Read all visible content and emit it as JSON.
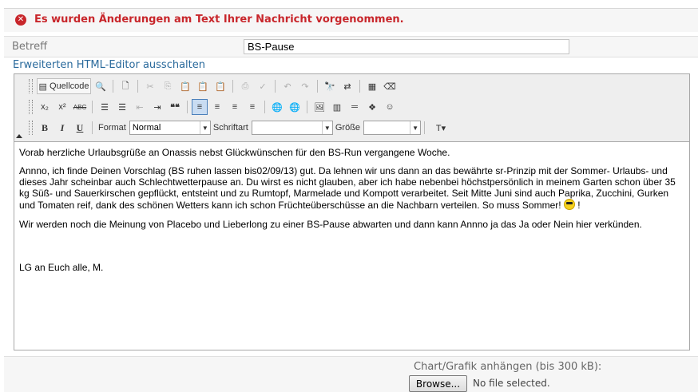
{
  "notice": {
    "text": "Es wurden Änderungen am Text Ihrer Nachricht vorgenommen.",
    "color": "#c8262b"
  },
  "subject": {
    "label": "Betreff",
    "value": "BS-Pause"
  },
  "editor_toggle": "Erweiterten HTML-Editor ausschalten",
  "toolbar": {
    "source_label": "Quellcode",
    "row1_icons": [
      "preview-icon",
      "new-page-icon",
      "cut-icon",
      "copy-icon",
      "paste-icon",
      "paste-text-icon",
      "paste-word-icon",
      "print-icon",
      "spellcheck-icon",
      "undo-icon",
      "redo-icon",
      "find-icon",
      "replace-icon",
      "select-all-icon",
      "remove-format-icon"
    ],
    "subscript": "x₂",
    "superscript": "x²",
    "strike": "ABC",
    "blockquote": "❝❝",
    "bold": "B",
    "italic": "I",
    "underline": "U",
    "format_label": "Format",
    "format_value": "Normal",
    "font_label": "Schriftart",
    "font_value": "",
    "size_label": "Größe",
    "size_value": ""
  },
  "content": {
    "p1": "Vorab herzliche Urlaubsgrüße an Onassis nebst Glückwünschen für den BS-Run vergangene Woche.",
    "p2": "Annno, ich finde Deinen Vorschlag (BS ruhen lassen bis02/09/13) gut. Da lehnen wir uns dann an das bewährte sr-Prinzip mit der Sommer- Urlaubs- und dieses Jahr scheinbar auch Schlechtwetterpause an. Du wirst es nicht glauben, aber ich habe nebenbei höchstpersönlich in meinem Garten schon über 35 kg Süß- und Sauerkirschen gepflückt, entsteint und zu Rumtopf, Marmelade und Kompott verarbeitet. Seit Mitte Juni sind auch Paprika, Zucchini, Gurken und Tomaten reif, dank des schönen Wetters kann ich schon Früchteüberschüsse an die Nachbarn verteilen. So muss Sommer!",
    "p2_end": " !",
    "p3": "Wir werden noch die Meinung von Placebo und Lieberlong zu einer BS-Pause abwarten und dann kann Annno ja das Ja oder Nein hier verkünden.",
    "p4": "LG an Euch alle,  M."
  },
  "attachment": {
    "label": "Chart/Grafik anhängen (bis 300 kB):",
    "browse": "Browse...",
    "status": "No file selected."
  }
}
